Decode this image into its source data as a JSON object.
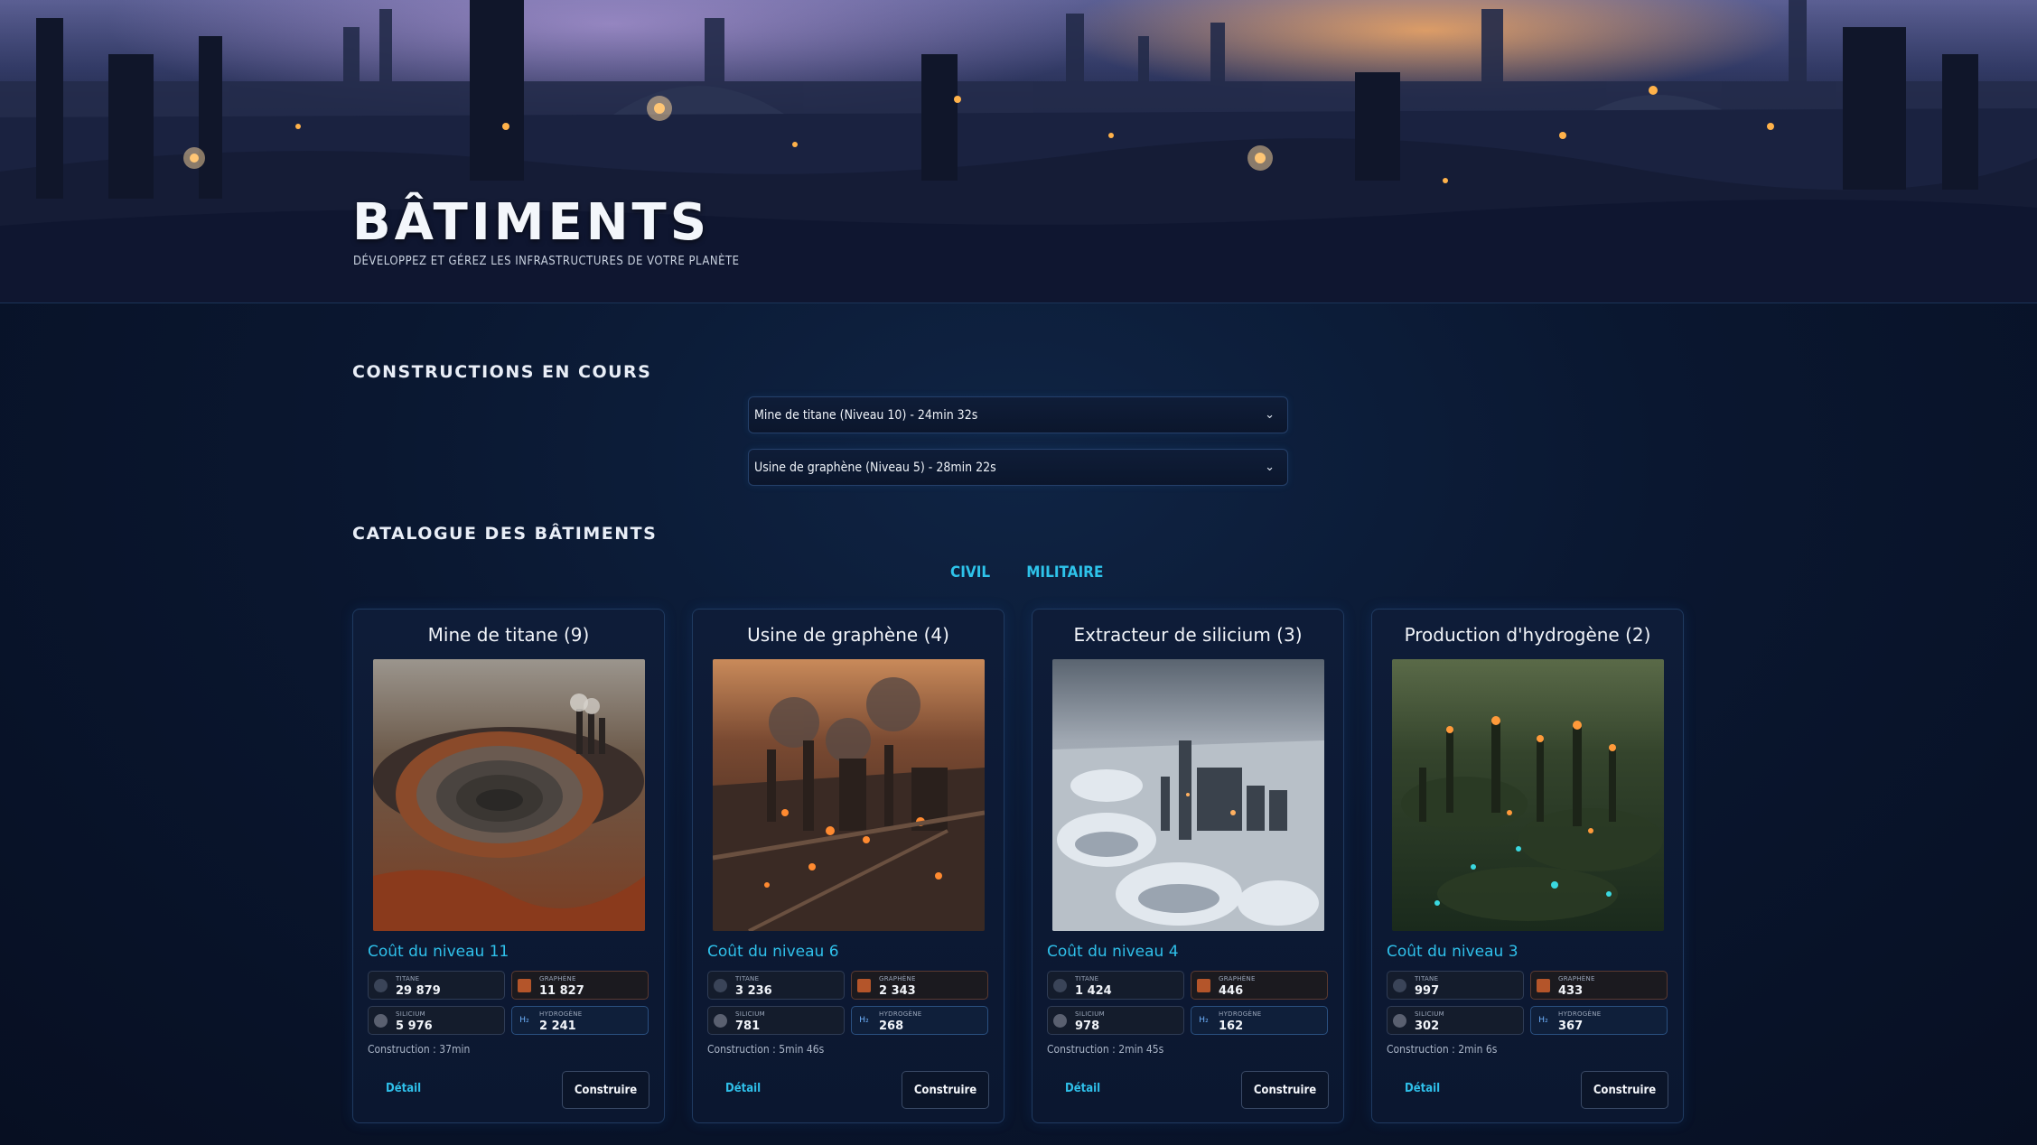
{
  "header": {
    "title": "BÂTIMENTS",
    "subtitle": "DÉVELOPPEZ ET GÉREZ LES INFRASTRUCTURES DE VOTRE PLANÈTE"
  },
  "construction_queue": {
    "title": "CONSTRUCTIONS EN COURS",
    "items": [
      {
        "label": "Mine de titane (Niveau 10) - 24min 32s"
      },
      {
        "label": "Usine de graphène (Niveau 5) - 28min 22s"
      }
    ]
  },
  "catalogue": {
    "title": "CATALOGUE DES BÂTIMENTS",
    "tabs": [
      "CIVIL",
      "MILITAIRE"
    ],
    "cards": [
      {
        "name": "Mine de titane (9)",
        "image": "titanium-mine-image",
        "cost_title": "Coût du niveau 11",
        "resources": {
          "titane": "29 879",
          "graphene": "11 827",
          "silicium": "5 976",
          "hydrogene": "2 241"
        },
        "construction": "Construction : 37min",
        "detail_label": "Détail",
        "build_label": "Construire"
      },
      {
        "name": "Usine de graphène (4)",
        "image": "graphene-factory-image",
        "cost_title": "Coût du niveau 6",
        "resources": {
          "titane": "3 236",
          "graphene": "2 343",
          "silicium": "781",
          "hydrogene": "268"
        },
        "construction": "Construction : 5min 46s",
        "detail_label": "Détail",
        "build_label": "Construire"
      },
      {
        "name": "Extracteur de silicium (3)",
        "image": "silicon-extractor-image",
        "cost_title": "Coût du niveau 4",
        "resources": {
          "titane": "1 424",
          "graphene": "446",
          "silicium": "978",
          "hydrogene": "162"
        },
        "construction": "Construction : 2min 45s",
        "detail_label": "Détail",
        "build_label": "Construire"
      },
      {
        "name": "Production d'hydrogène (2)",
        "image": "hydrogen-plant-image",
        "cost_title": "Coût du niveau 3",
        "resources": {
          "titane": "997",
          "graphene": "433",
          "silicium": "302",
          "hydrogene": "367"
        },
        "construction": "Construction : 2min 6s",
        "detail_label": "Détail",
        "build_label": "Construire"
      }
    ],
    "resource_labels": {
      "titane": "TITANE",
      "graphene": "GRAPHÈNE",
      "silicium": "SILICIUM",
      "hydrogene": "HYDROGÈNE"
    },
    "hydrogen_symbol": "H₂"
  },
  "colors": {
    "accent": "#2fc0ea",
    "background": "#0a1730",
    "card_border": "#1f3a60"
  }
}
